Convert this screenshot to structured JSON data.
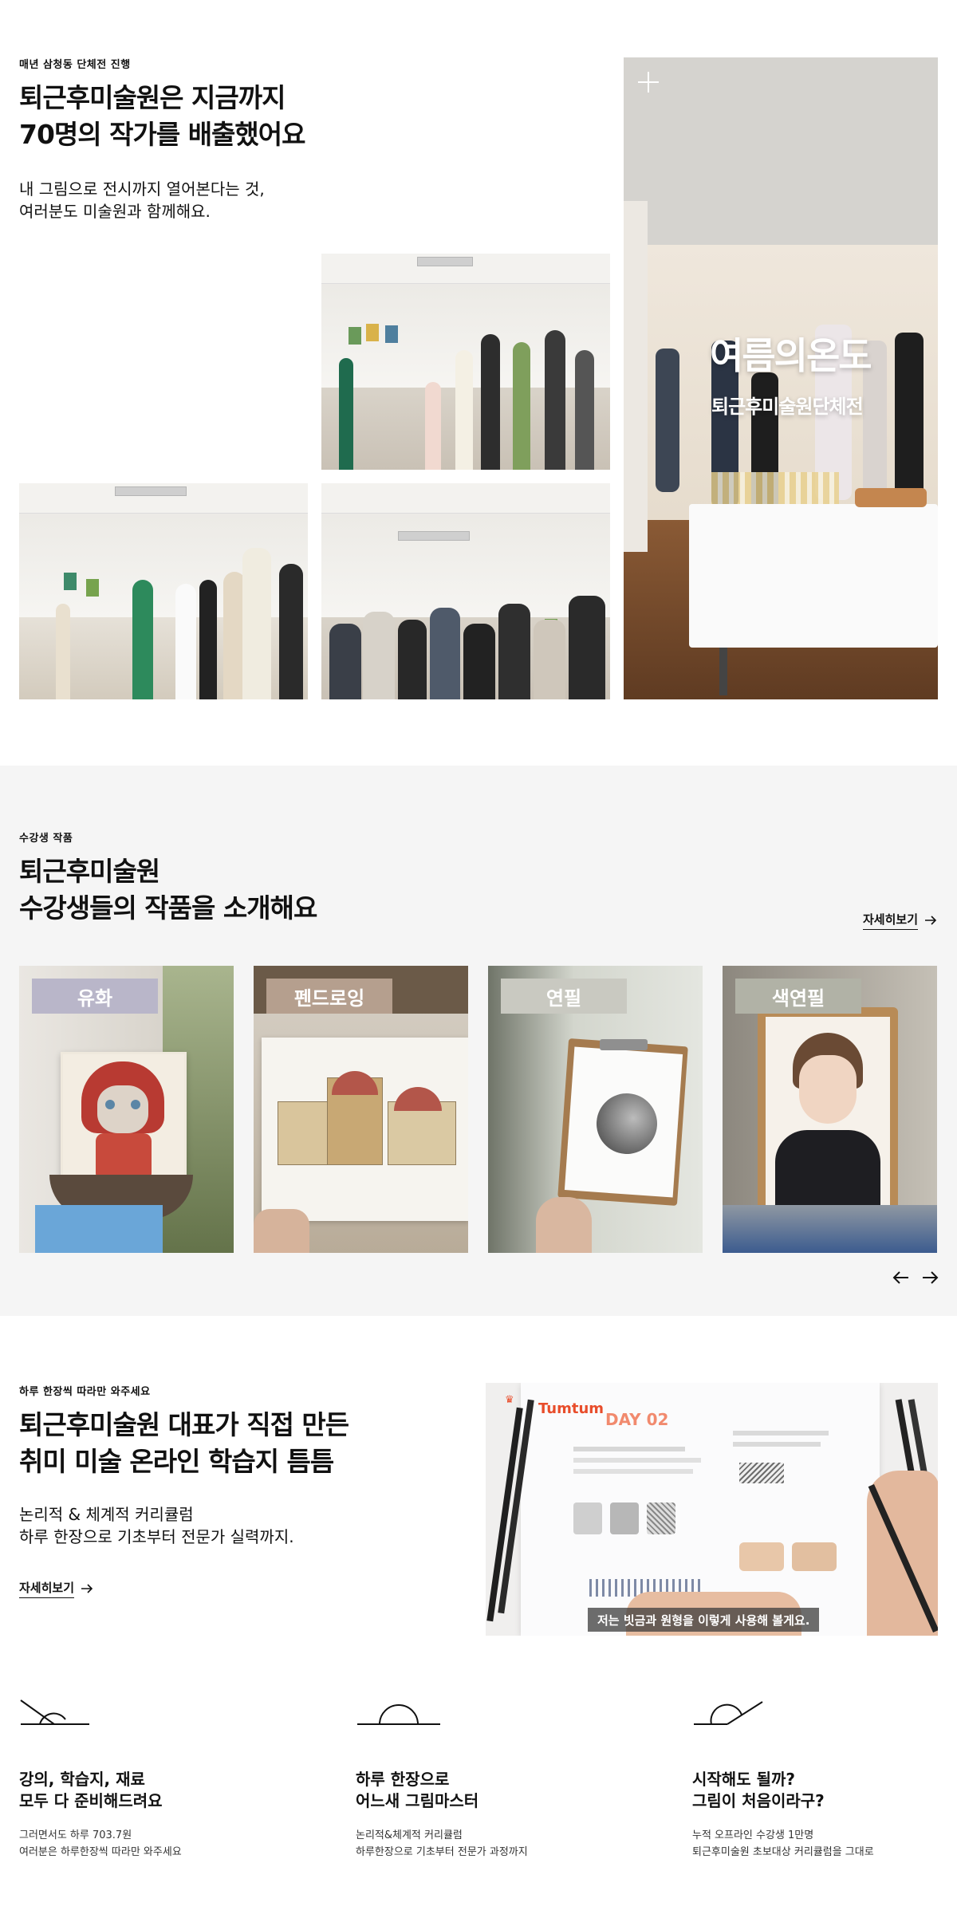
{
  "hero": {
    "eyebrow": "매년 삼청동 단체전 진행",
    "title": "퇴근후미술원은 지금까지\n70명의 작가를 배출했어요",
    "lead": "내 그림으로 전시까지 열어본다는 것,\n여러분도 미술원과 함께해요.",
    "feature_photo": {
      "overlay_title": "여름의온도",
      "overlay_subtitle": "퇴근후미술원단체전",
      "plus_icon": "plus-icon"
    }
  },
  "works": {
    "eyebrow": "수강생 작품",
    "title": "퇴근후미술원\n수강생들의 작품을 소개해요",
    "more_label": "자세히보기",
    "cards": [
      {
        "label": "유화",
        "label_color": "#b9b6c9"
      },
      {
        "label": "펜드로잉",
        "label_color": "#b59f8e"
      },
      {
        "label": "연필",
        "label_color": "#c9c9c1"
      },
      {
        "label": "색연필",
        "label_color": "#b1b2a6"
      }
    ]
  },
  "workbook": {
    "eyebrow": "하루 한장씩 따라만 와주세요",
    "title": "퇴근후미술원 대표가 직접 만든\n취미 미술 온라인 학습지 틈틈",
    "lead": "논리적 & 체계적 커리큘럼\n하루 한장으로 기초부터 전문가 실력까지.",
    "more_label": "자세히보기",
    "photo": {
      "brand": "Tumtum",
      "day": "DAY 02",
      "caption": "저는 빗금과 원형을 이렇게 사용해 볼게요."
    }
  },
  "features": [
    {
      "icon": "sunrise-low-icon",
      "title": "강의, 학습지, 재료\n모두 다 준비해드려요",
      "sub": "그러면서도 하루 703.7원\n여러분은 하루한장씩 따라만 와주세요"
    },
    {
      "icon": "sun-rising-icon",
      "title": "하루 한장으로\n어느새 그림마스터",
      "sub": "논리적&체계적 커리큘럼\n하루한장으로 기초부터 전문가 과정까지"
    },
    {
      "icon": "sunrise-tilt-icon",
      "title": "시작해도 될까?\n그림이 처음이라구?",
      "sub": "누적 오프라인 수강생 1만명\n퇴근후미술원 초보대상 커리큘럼을 그대로"
    }
  ]
}
